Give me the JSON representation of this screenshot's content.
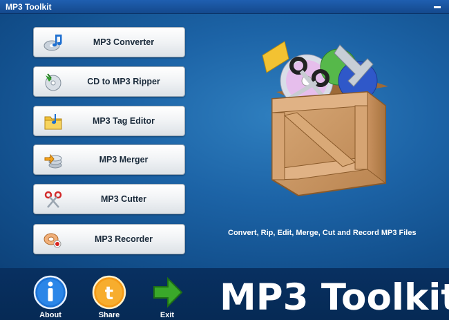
{
  "window": {
    "title": "MP3 Toolkit"
  },
  "tools": [
    {
      "label": "MP3 Converter",
      "icon": "music-note-icon"
    },
    {
      "label": "CD to MP3 Ripper",
      "icon": "cd-rip-icon"
    },
    {
      "label": "MP3 Tag Editor",
      "icon": "tag-folder-icon"
    },
    {
      "label": "MP3 Merger",
      "icon": "merge-disc-icon"
    },
    {
      "label": "MP3 Cutter",
      "icon": "scissors-icon"
    },
    {
      "label": "MP3 Recorder",
      "icon": "record-icon"
    }
  ],
  "tagline": "Convert, Rip, Edit, Merge, Cut and Record MP3 Files",
  "bottom_bar": {
    "about": "About",
    "share": "Share",
    "exit": "Exit",
    "brand": "MP3 Toolkit"
  },
  "colors": {
    "title_bar": "#1f5fb0",
    "background": "#1c63a6",
    "bottom_bar": "#083061",
    "about_blue": "#1e74d6",
    "share_orange": "#f49a16",
    "exit_green": "#3aa82a"
  }
}
